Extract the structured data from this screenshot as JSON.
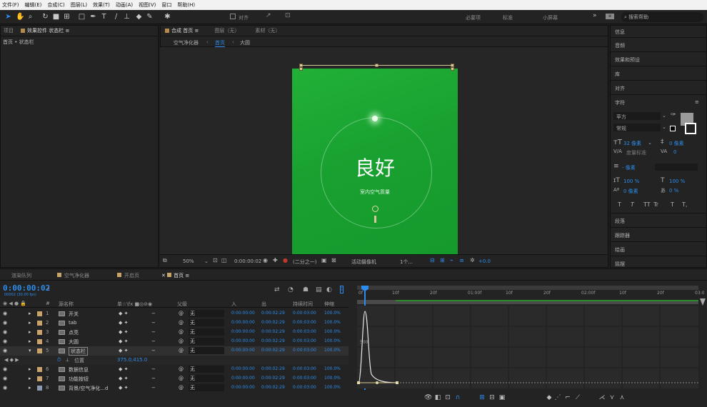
{
  "menu": [
    "文件(F)",
    "编辑(E)",
    "合成(C)",
    "图层(L)",
    "效果(T)",
    "动画(A)",
    "视图(V)",
    "窗口",
    "帮助(H)"
  ],
  "toolbar": {
    "align_label": "对齐",
    "workspaces": [
      "必要项",
      "标准",
      "小屏幕"
    ],
    "search_placeholder": "搜索帮助"
  },
  "left_panel": {
    "tabs": [
      "项目",
      "效果控件 状态栏"
    ],
    "breadcrumb": "首页 • 状态栏"
  },
  "comp_panel": {
    "tabs": [
      "合成 首页",
      "图层（无）",
      "素材（无）"
    ],
    "breadcrumbs": [
      "空气净化器",
      "首页",
      "大圆"
    ],
    "status_main": "良好",
    "status_sub": "室内空气质量",
    "footer": {
      "zoom": "50%",
      "timecode": "0:00:00:02",
      "resolution": "(二分之一)",
      "camera": "活动摄像机",
      "views": "1个...",
      "exposure": "+0.0"
    }
  },
  "right_panel": {
    "sections": [
      "信息",
      "音频",
      "效果和预设",
      "库",
      "对齐",
      "字符"
    ],
    "font_family": "苹方",
    "font_style": "常规",
    "font_size": "32 像素",
    "leading": "0 像素",
    "kerning": "度量标准",
    "tracking": "0",
    "stroke": "- 像素",
    "vscale": "100 %",
    "hscale": "100 %",
    "baseline": "0 像素",
    "tsume": "0 %",
    "type_buttons": [
      "T",
      "T",
      "TT",
      "Tr",
      "T",
      "T,"
    ],
    "sections_bottom": [
      "段落",
      "跟踪器",
      "绘画",
      "摇摆"
    ]
  },
  "timeline": {
    "tabs": [
      "渲染队列",
      "空气净化器",
      "开启页",
      "首页"
    ],
    "timecode": "0:00:00:02",
    "fps": "00002 (30.00 fps)",
    "columns": [
      "#",
      "源名称",
      "单☆\\fx ■◎⊘◉",
      "父级",
      "入",
      "出",
      "持续时间",
      "伸缩"
    ],
    "layers": [
      {
        "num": "1",
        "name": "开关",
        "parent": "无",
        "in": "0:00:00:00",
        "out": "0:00:02:29",
        "dur": "0:00:03:00",
        "stretch": "100.0%",
        "color": "#c9a46a"
      },
      {
        "num": "2",
        "name": "tab",
        "parent": "无",
        "in": "0:00:00:00",
        "out": "0:00:02:29",
        "dur": "0:00:03:00",
        "stretch": "100.0%",
        "color": "#c9a46a"
      },
      {
        "num": "3",
        "name": "点亮",
        "parent": "无",
        "in": "0:00:00:00",
        "out": "0:00:02:29",
        "dur": "0:00:03:00",
        "stretch": "100.0%",
        "color": "#c9a46a"
      },
      {
        "num": "4",
        "name": "大圆",
        "parent": "无",
        "in": "0:00:00:00",
        "out": "0:00:02:29",
        "dur": "0:00:03:00",
        "stretch": "100.0%",
        "color": "#c9a46a"
      },
      {
        "num": "5",
        "name": "状态栏",
        "parent": "无",
        "in": "0:00:00:00",
        "out": "0:00:02:29",
        "dur": "0:00:03:00",
        "stretch": "100.0%",
        "color": "#c9a46a"
      },
      {
        "num": "6",
        "name": "数据信息",
        "parent": "无",
        "in": "0:00:00:00",
        "out": "0:00:02:29",
        "dur": "0:00:03:00",
        "stretch": "100.0%",
        "color": "#c9a46a"
      },
      {
        "num": "7",
        "name": "功能按钮",
        "parent": "无",
        "in": "0:00:00:00",
        "out": "0:00:02:29",
        "dur": "0:00:03:00",
        "stretch": "100.0%",
        "color": "#c9a46a"
      },
      {
        "num": "8",
        "name": "背景/空气净化...d",
        "parent": "无",
        "in": "0:00:00:00",
        "out": "0:00:02:29",
        "dur": "0:00:03:00",
        "stretch": "100.0%",
        "color": "#8a9ab0"
      }
    ],
    "property": {
      "name": "位置",
      "value": "375.0,415.0"
    },
    "ruler_ticks": [
      "0f",
      "10f",
      "20f",
      "01:00f",
      "10f",
      "20f",
      "02:00f",
      "10f",
      "20f",
      "03:0"
    ],
    "graph_label": "500"
  },
  "colors": {
    "accent": "#2d8ceb",
    "artboard": "#1aa434",
    "label": "#c9a46a"
  }
}
